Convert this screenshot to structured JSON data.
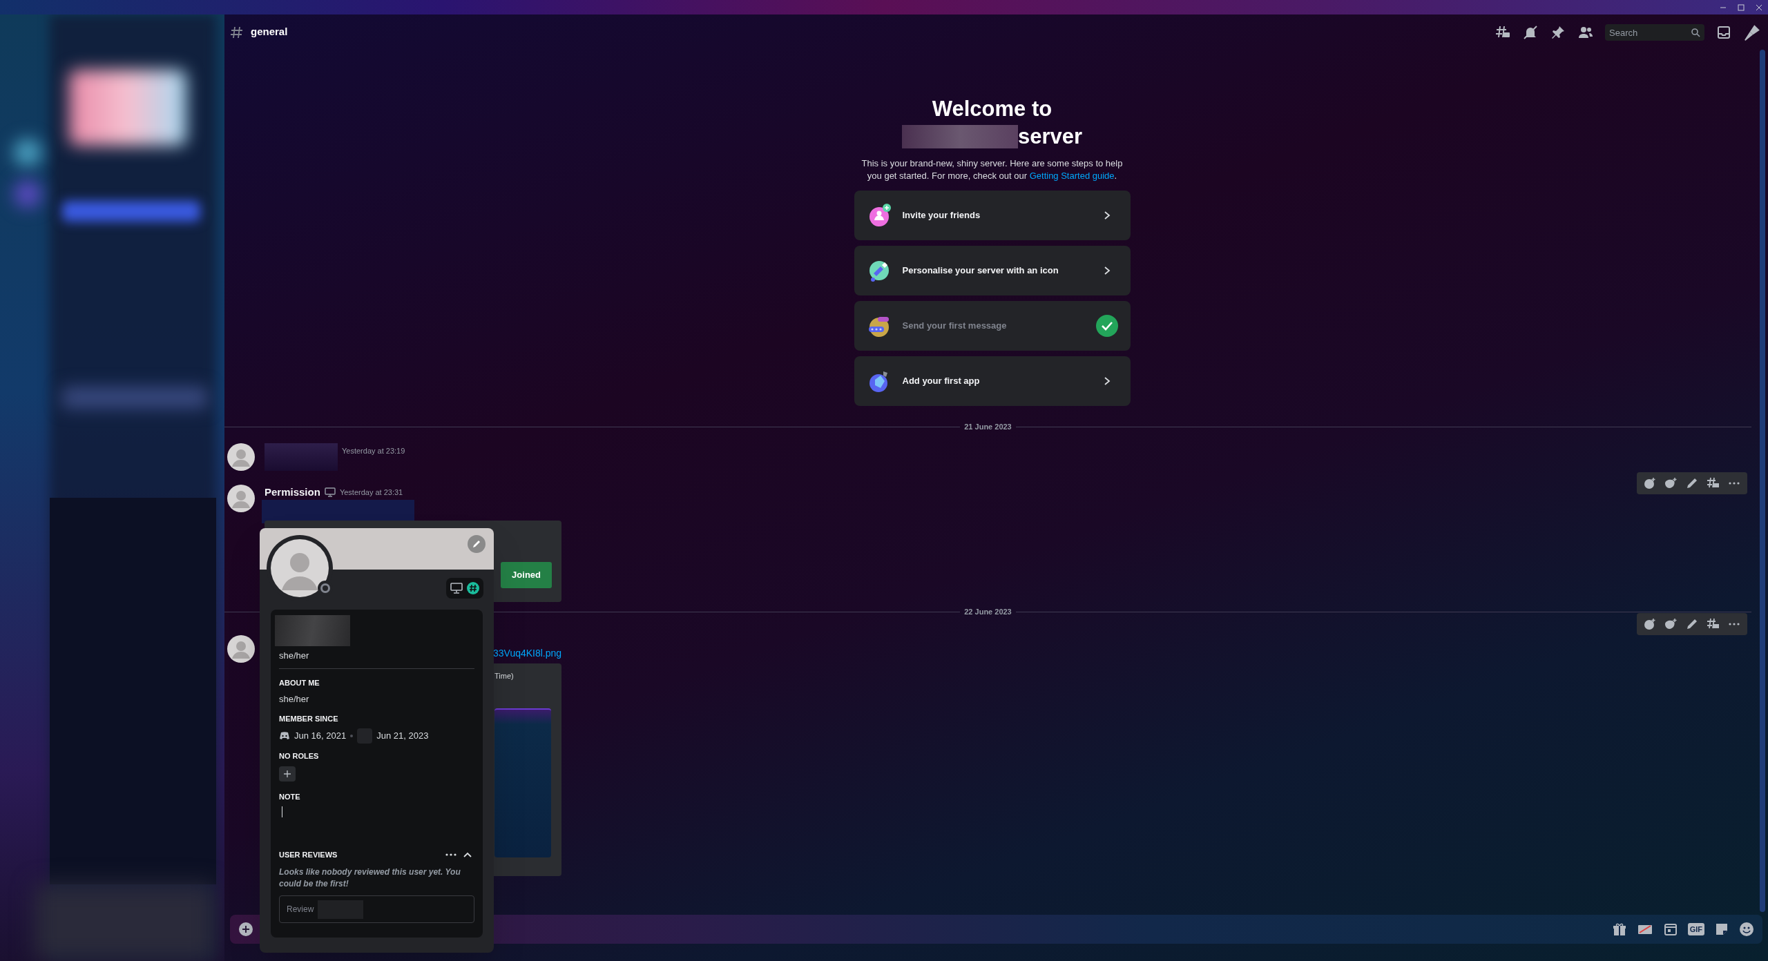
{
  "channel_header": {
    "name": "general",
    "search_placeholder": "Search"
  },
  "welcome": {
    "title": "Welcome to",
    "title_suffix": "server",
    "description": "This is your brand-new, shiny server. Here are some steps to help you get started. For more, check out our ",
    "link": "Getting Started guide",
    "after_link": "."
  },
  "steps": [
    {
      "kind": "invite",
      "label": "Invite your friends",
      "done": false
    },
    {
      "kind": "personalise",
      "label": "Personalise your server with an icon",
      "done": false
    },
    {
      "kind": "message",
      "label": "Send your first message",
      "done": true
    },
    {
      "kind": "app",
      "label": "Add your first app",
      "done": false
    }
  ],
  "feed": [
    {
      "kind": "date",
      "text": "21 June 2023"
    },
    {
      "kind": "message",
      "timestamp": "Yesterday at 23:19"
    },
    {
      "kind": "message",
      "author": "Permission",
      "timestamp": "Yesterday at 23:31",
      "button": "Joined"
    },
    {
      "kind": "date",
      "text": "22 June 2023"
    },
    {
      "kind": "attachment",
      "link": "33Vuq4KI8l.png",
      "embed_text": "Time)"
    }
  ],
  "profile_popup": {
    "pronouns": "she/her",
    "about_heading": "ABOUT ME",
    "about_text": "she/her",
    "member_heading": "MEMBER SINCE",
    "discord_date": "Jun 16, 2021",
    "server_date": "Jun 21, 2023",
    "roles_heading": "NO ROLES",
    "note_heading": "NOTE",
    "reviews_heading": "USER REVIEWS",
    "reviews_empty": "Looks like nobody reviewed this user yet. You could be the first!",
    "review_placeholder": "Review"
  },
  "composer": {
    "gif_label": "GIF"
  }
}
